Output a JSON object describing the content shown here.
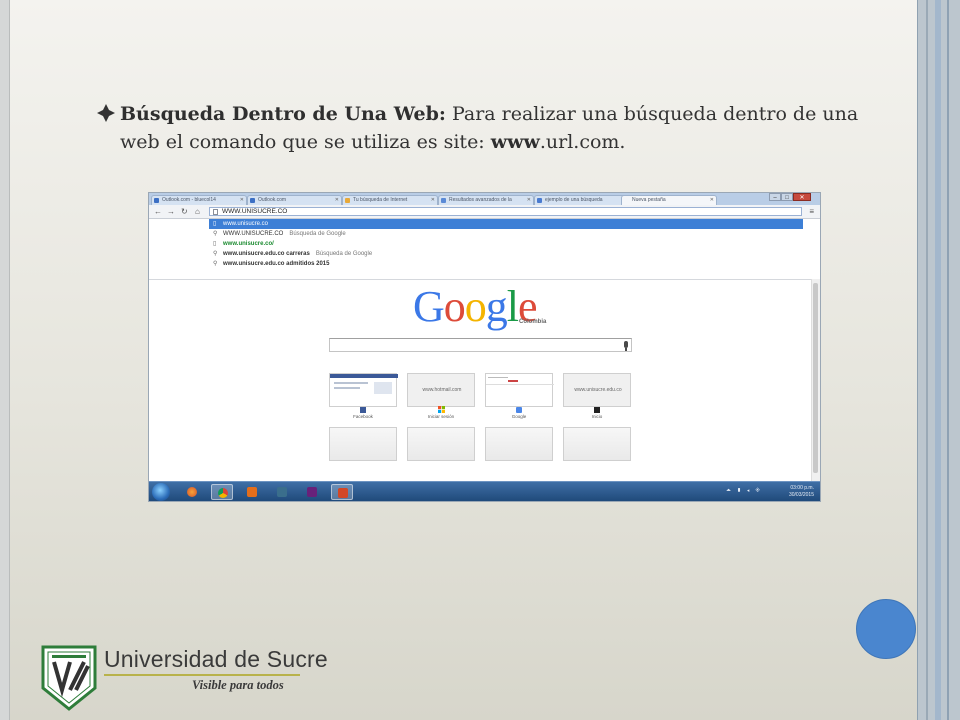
{
  "slide": {
    "bullet_title": "Búsqueda Dentro de Una Web:",
    "bullet_text": " Para realizar una búsqueda dentro de una web el comando que se utiliza es site: ",
    "bullet_bold_end": "www",
    "bullet_tail": ".url.com.",
    "accent_color": "#4a86cf"
  },
  "browser": {
    "tabs": [
      {
        "label": "Outlook.com - bluecol14"
      },
      {
        "label": "Outlook.com"
      },
      {
        "label": "Tu búsqueda de Internet"
      },
      {
        "label": "Resultados avanzados de la"
      },
      {
        "label": "ejemplo de una búsqueda"
      },
      {
        "label": "Nueva pestaña"
      }
    ],
    "address": "WWW.UNISUCRE.CO",
    "suggestions": [
      {
        "icon": "page-icon",
        "text": "www.unisucre.co",
        "note": ""
      },
      {
        "icon": "search-icon",
        "text": "WWW.UNISUCRE.CO",
        "note": "Búsqueda de Google"
      },
      {
        "icon": "page-icon",
        "text": "www.unisucre.co/",
        "note": ""
      },
      {
        "icon": "search-icon",
        "text": "www.unisucre.edu.co carreras",
        "note": "Búsqueda de Google"
      },
      {
        "icon": "search-icon",
        "text": "www.unisucre.edu.co admitidos 2015",
        "note": ""
      }
    ],
    "logo_sub": "Colombia",
    "tiles": [
      {
        "url": "",
        "label": "Facebook"
      },
      {
        "url": "www.hotmail.com",
        "label": "Iniciar sesión"
      },
      {
        "url": "",
        "label": "Google"
      },
      {
        "url": "www.unisucre.edu.co",
        "label": "Inicio"
      }
    ],
    "tray": {
      "time": "03:00 p.m.",
      "date": "30/03/2015"
    }
  },
  "university": {
    "name": "Universidad de Sucre",
    "tagline": "Visible para todos",
    "seal_text": "UNIVERSIDAD DE SUCRE"
  }
}
